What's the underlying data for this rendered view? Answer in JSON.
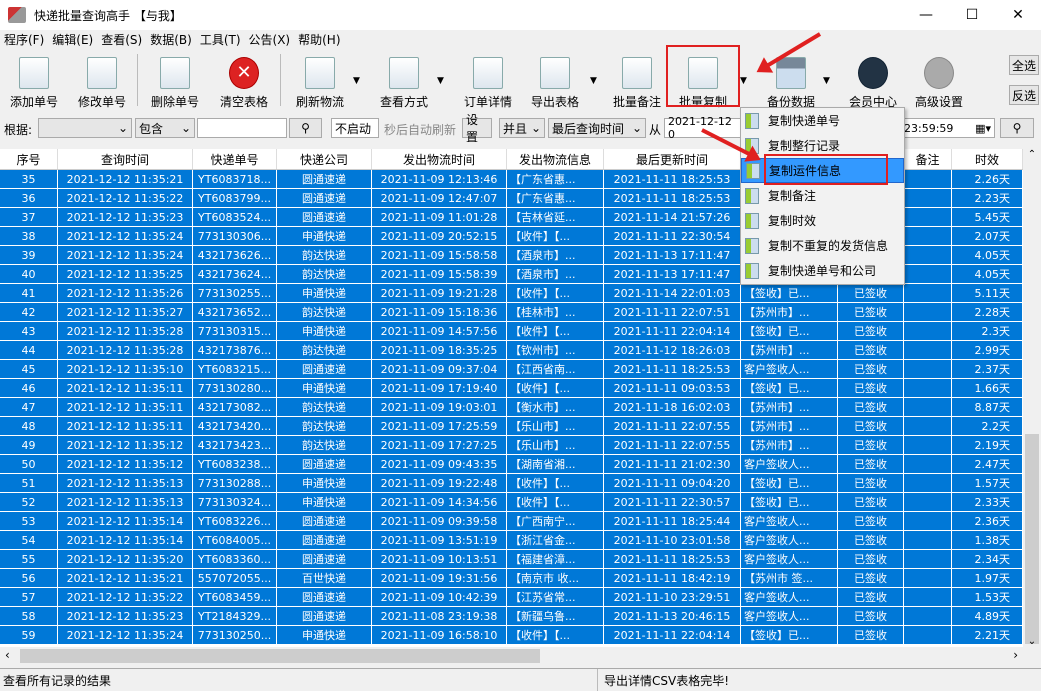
{
  "window": {
    "title": "快递批量查询高手 【与我】",
    "minimize": "—",
    "maximize": "☐",
    "close": "✕"
  },
  "menu": [
    "程序(F)",
    "编辑(E)",
    "查看(S)",
    "数据(B)",
    "工具(T)",
    "公告(X)",
    "帮助(H)"
  ],
  "toolbar": [
    {
      "label": "添加单号",
      "icon": "file-icon"
    },
    {
      "label": "修改单号",
      "icon": "pencil-icon"
    },
    {
      "label": "删除单号",
      "icon": "delete-file-icon"
    },
    {
      "label": "清空表格",
      "icon": "clear-icon"
    },
    {
      "label": "刷新物流",
      "icon": "refresh-list-icon"
    },
    {
      "label": "查看方式",
      "icon": "view-mode-icon"
    },
    {
      "label": "订单详情",
      "icon": "detail-icon"
    },
    {
      "label": "导出表格",
      "icon": "export-icon"
    },
    {
      "label": "批量备注",
      "icon": "note-icon"
    },
    {
      "label": "批量复制",
      "icon": "copy-icon"
    },
    {
      "label": "备份数据",
      "icon": "disk-icon"
    },
    {
      "label": "会员中心",
      "icon": "clock-icon"
    },
    {
      "label": "高级设置",
      "icon": "gear-icon"
    }
  ],
  "side_buttons": {
    "select_all": "全选",
    "invert": "反选"
  },
  "filter": {
    "by_label": "根据:",
    "by_value": "",
    "op_value": "包含",
    "search_value": "",
    "auto_refresh": "不启动",
    "auto_refresh_label": "秒后自动刷新",
    "settings": "设置",
    "logic": "并且",
    "time_field": "最后查询时间",
    "from_label": "从",
    "from_value": "2021-12-12 0",
    "to_value": "23:59:59"
  },
  "table": {
    "columns": [
      "序号",
      "查询时间",
      "快递单号",
      "快递公司",
      "发出物流时间",
      "发出物流信息",
      "最后更新时间",
      "",
      "",
      "备注",
      "时效"
    ],
    "rows": [
      [
        "35",
        "2021-12-12 11:35:21",
        "YT6083718...",
        "圆通速递",
        "2021-11-09 12:13:46",
        "【广东省惠...",
        "2021-11-11 18:25:53",
        "",
        "",
        "",
        "2.26天"
      ],
      [
        "36",
        "2021-12-12 11:35:22",
        "YT6083799...",
        "圆通速递",
        "2021-11-09 12:47:07",
        "【广东省惠...",
        "2021-11-11 18:25:53",
        "",
        "",
        "",
        "2.23天"
      ],
      [
        "37",
        "2021-12-12 11:35:23",
        "YT6083524...",
        "圆通速递",
        "2021-11-09 11:01:28",
        "【吉林省延...",
        "2021-11-14 21:57:26",
        "",
        "",
        "",
        "5.45天"
      ],
      [
        "38",
        "2021-12-12 11:35:24",
        "773130306...",
        "申通快递",
        "2021-11-09 20:52:15",
        "【收件】【...",
        "2021-11-11 22:30:54",
        "",
        "",
        "",
        "2.07天"
      ],
      [
        "39",
        "2021-12-12 11:35:24",
        "432173626...",
        "韵达快递",
        "2021-11-09 15:58:58",
        "【酒泉市】...",
        "2021-11-13 17:11:47",
        "",
        "",
        "",
        "4.05天"
      ],
      [
        "40",
        "2021-12-12 11:35:25",
        "432173624...",
        "韵达快递",
        "2021-11-09 15:58:39",
        "【酒泉市】...",
        "2021-11-13 17:11:47",
        "",
        "",
        "",
        "4.05天"
      ],
      [
        "41",
        "2021-12-12 11:35:26",
        "773130255...",
        "申通快递",
        "2021-11-09 19:21:28",
        "【收件】【...",
        "2021-11-14 22:01:03",
        "【签收】已...",
        "已签收",
        "",
        "5.11天"
      ],
      [
        "42",
        "2021-12-12 11:35:27",
        "432173652...",
        "韵达快递",
        "2021-11-09 15:18:36",
        "【桂林市】...",
        "2021-11-11 22:07:51",
        "【苏州市】...",
        "已签收",
        "",
        "2.28天"
      ],
      [
        "43",
        "2021-12-12 11:35:28",
        "773130315...",
        "申通快递",
        "2021-11-09 14:57:56",
        "【收件】【...",
        "2021-11-11 22:04:14",
        "【签收】已...",
        "已签收",
        "",
        "2.3天"
      ],
      [
        "44",
        "2021-12-12 11:35:28",
        "432173876...",
        "韵达快递",
        "2021-11-09 18:35:25",
        "【钦州市】...",
        "2021-11-12 18:26:03",
        "【苏州市】...",
        "已签收",
        "",
        "2.99天"
      ],
      [
        "45",
        "2021-12-12 11:35:10",
        "YT6083215...",
        "圆通速递",
        "2021-11-09 09:37:04",
        "【江西省南...",
        "2021-11-11 18:25:53",
        "客户签收人...",
        "已签收",
        "",
        "2.37天"
      ],
      [
        "46",
        "2021-12-12 11:35:11",
        "773130280...",
        "申通快递",
        "2021-11-09 17:19:40",
        "【收件】【...",
        "2021-11-11 09:03:53",
        "【签收】已...",
        "已签收",
        "",
        "1.66天"
      ],
      [
        "47",
        "2021-12-12 11:35:11",
        "432173082...",
        "韵达快递",
        "2021-11-09 19:03:01",
        "【衡水市】...",
        "2021-11-18 16:02:03",
        "【苏州市】...",
        "已签收",
        "",
        "8.87天"
      ],
      [
        "48",
        "2021-12-12 11:35:11",
        "432173420...",
        "韵达快递",
        "2021-11-09 17:25:59",
        "【乐山市】...",
        "2021-11-11 22:07:55",
        "【苏州市】...",
        "已签收",
        "",
        "2.2天"
      ],
      [
        "49",
        "2021-12-12 11:35:12",
        "432173423...",
        "韵达快递",
        "2021-11-09 17:27:25",
        "【乐山市】...",
        "2021-11-11 22:07:55",
        "【苏州市】...",
        "已签收",
        "",
        "2.19天"
      ],
      [
        "50",
        "2021-12-12 11:35:12",
        "YT6083238...",
        "圆通速递",
        "2021-11-09 09:43:35",
        "【湖南省湘...",
        "2021-11-11 21:02:30",
        "客户签收人...",
        "已签收",
        "",
        "2.47天"
      ],
      [
        "51",
        "2021-12-12 11:35:13",
        "773130288...",
        "申通快递",
        "2021-11-09 19:22:48",
        "【收件】【...",
        "2021-11-11 09:04:20",
        "【签收】已...",
        "已签收",
        "",
        "1.57天"
      ],
      [
        "52",
        "2021-12-12 11:35:13",
        "773130324...",
        "申通快递",
        "2021-11-09 14:34:56",
        "【收件】【...",
        "2021-11-11 22:30:57",
        "【签收】已...",
        "已签收",
        "",
        "2.33天"
      ],
      [
        "53",
        "2021-12-12 11:35:14",
        "YT6083226...",
        "圆通速递",
        "2021-11-09 09:39:58",
        "【广西南宁...",
        "2021-11-11 18:25:44",
        "客户签收人...",
        "已签收",
        "",
        "2.36天"
      ],
      [
        "54",
        "2021-12-12 11:35:14",
        "YT6084005...",
        "圆通速递",
        "2021-11-09 13:51:19",
        "【浙江省金...",
        "2021-11-10 23:01:58",
        "客户签收人...",
        "已签收",
        "",
        "1.38天"
      ],
      [
        "55",
        "2021-12-12 11:35:20",
        "YT6083360...",
        "圆通速递",
        "2021-11-09 10:13:51",
        "【福建省漳...",
        "2021-11-11 18:25:53",
        "客户签收人...",
        "已签收",
        "",
        "2.34天"
      ],
      [
        "56",
        "2021-12-12 11:35:21",
        "557072055...",
        "百世快递",
        "2021-11-09 19:31:56",
        "【南京市 收...",
        "2021-11-11 18:42:19",
        "【苏州市 签...",
        "已签收",
        "",
        "1.97天"
      ],
      [
        "57",
        "2021-12-12 11:35:22",
        "YT6083459...",
        "圆通速递",
        "2021-11-09 10:42:39",
        "【江苏省常...",
        "2021-11-10 23:29:51",
        "客户签收人...",
        "已签收",
        "",
        "1.53天"
      ],
      [
        "58",
        "2021-12-12 11:35:23",
        "YT2184329...",
        "圆通速递",
        "2021-11-08 23:19:38",
        "【新疆乌鲁...",
        "2021-11-13 20:46:15",
        "客户签收人...",
        "已签收",
        "",
        "4.89天"
      ],
      [
        "59",
        "2021-12-12 11:35:24",
        "773130250...",
        "申通快递",
        "2021-11-09 16:58:10",
        "【收件】【...",
        "2021-11-11 22:04:14",
        "【签收】已...",
        "已签收",
        "",
        "2.21天"
      ]
    ]
  },
  "popup_menu": {
    "items": [
      "复制快递单号",
      "复制整行记录",
      "复制运件信息",
      "复制备注",
      "复制时效",
      "复制不重复的发货信息",
      "复制快递单号和公司"
    ],
    "active": "复制运件信息"
  },
  "status": {
    "left": "查看所有记录的结果",
    "right": "导出详情CSV表格完毕!"
  },
  "colors": {
    "selection": "#0078d7",
    "highlight": "#3399ff",
    "annotation": "#e02020"
  }
}
